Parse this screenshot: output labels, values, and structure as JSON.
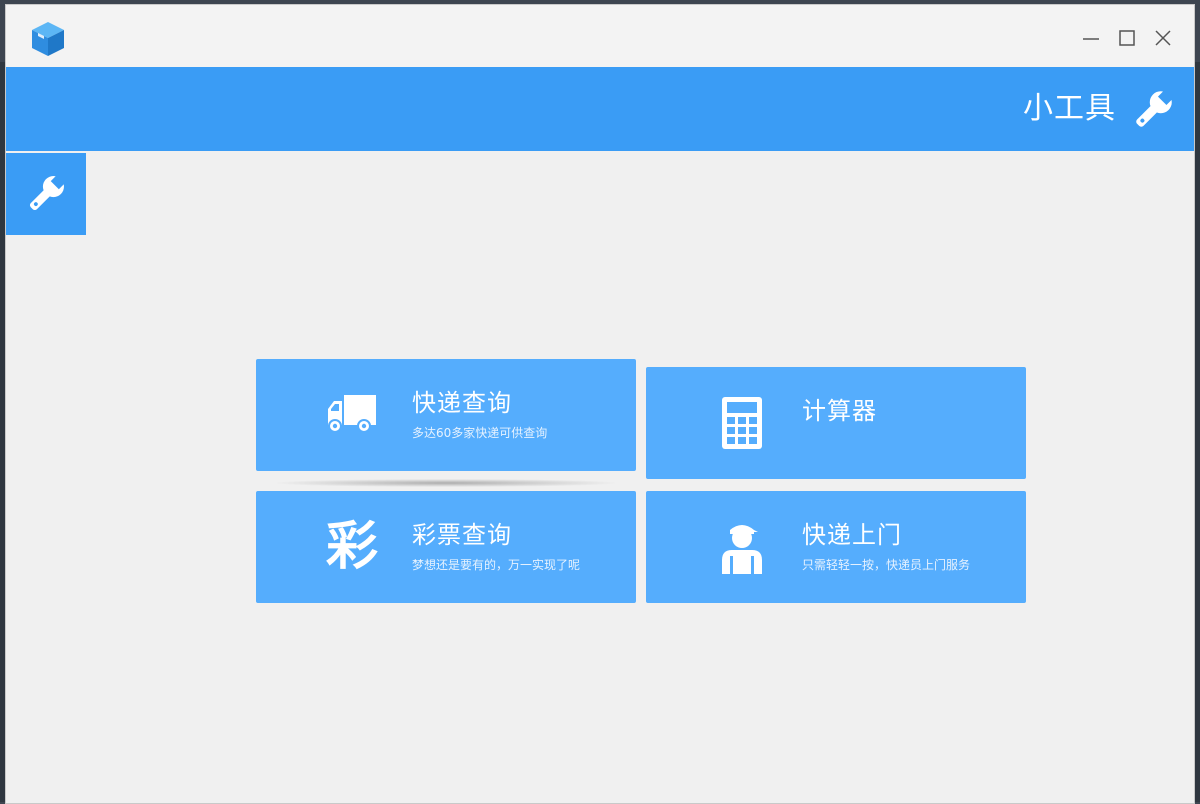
{
  "window": {
    "logo_icon": "cube-box-icon",
    "controls": {
      "minimize_icon": "minimize-icon",
      "maximize_icon": "maximize-icon",
      "close_icon": "close-icon"
    }
  },
  "header": {
    "title": "小工具",
    "icon": "wrench-icon"
  },
  "sidebar": {
    "active_tab_icon": "wrench-icon"
  },
  "tiles": [
    {
      "title": "快递查询",
      "subtitle": "多达60多家快递可供查询",
      "icon": "delivery-truck-icon"
    },
    {
      "title": "计算器",
      "subtitle": "",
      "icon": "calculator-icon"
    },
    {
      "title": "彩票查询",
      "subtitle": "梦想还是要有的，万一实现了呢",
      "icon_text": "彩"
    },
    {
      "title": "快递上门",
      "subtitle": "只需轻轻一按，快递员上门服务",
      "icon": "courier-person-icon"
    }
  ],
  "colors": {
    "accent": "#3a9cf5",
    "tile": "#55adfd",
    "background": "#f0f0f0"
  }
}
